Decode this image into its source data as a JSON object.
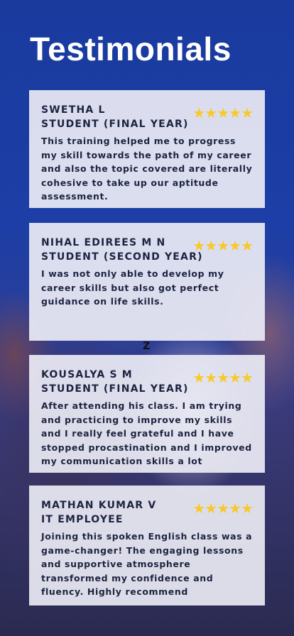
{
  "title": "Testimonials",
  "stars_icon": "★★★★★",
  "rating": 5,
  "marker": "Z",
  "testimonials": [
    {
      "name": "SWETHA L",
      "role": "STUDENT (FINAL YEAR)",
      "text": "This training helped me to progress my skill towards the path of my career and also the topic covered are literally cohesive to take up our aptitude assessment."
    },
    {
      "name": "NIHAL EDIREES M N",
      "role": "STUDENT (SECOND YEAR)",
      "text": "I was not only able to develop my career skills but also got perfect guidance on life skills."
    },
    {
      "name": "KOUSALYA S M",
      "role": "STUDENT (FINAL YEAR)",
      "text": "After attending his class. I am trying and practicing to improve my skills and I really feel grateful and I have stopped procastination and I improved my communication skills a lot"
    },
    {
      "name": "MATHAN KUMAR V",
      "role": "IT EMPLOYEE",
      "text": "Joining this spoken English class was a game-changer! The engaging lessons and supportive atmosphere transformed my confidence and fluency. Highly recommend"
    }
  ]
}
